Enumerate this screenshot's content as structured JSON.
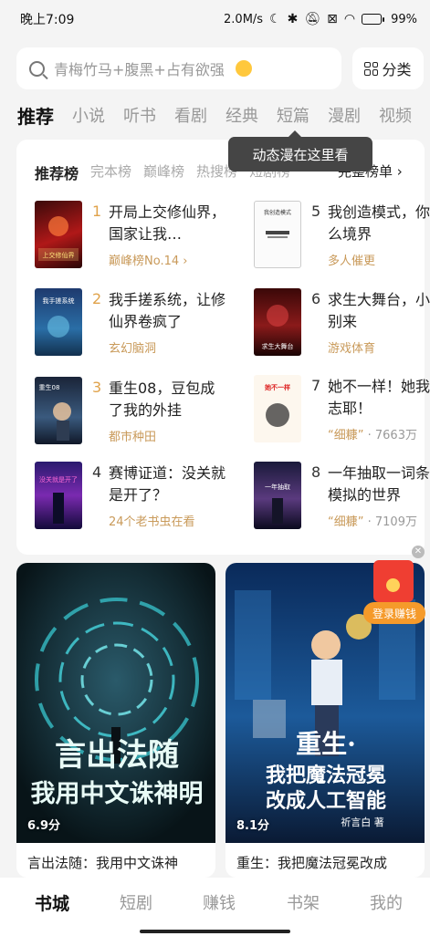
{
  "status_bar": {
    "time": "晚上7:09",
    "speed": "2.0M/s",
    "battery": "99%",
    "battery_level": 0.99
  },
  "search": {
    "placeholder": "青梅竹马+腹黑+占有欲强"
  },
  "category_button": "分类",
  "category_tabs": [
    "推荐",
    "小说",
    "听书",
    "看剧",
    "经典",
    "短篇",
    "漫剧",
    "视频"
  ],
  "tooltip": "动态漫在这里看",
  "ranking": {
    "tabs": [
      "推荐榜",
      "完本榜",
      "巅峰榜",
      "热搜榜",
      "短剧榜"
    ],
    "full_list": "完整榜单 ›",
    "books": [
      {
        "rank": "1",
        "title": "开局上交修仙界，国家让我…",
        "sub": "巅峰榜No.14 ›",
        "sub2": ""
      },
      {
        "rank": "2",
        "title": "我手搓系统，让修仙界卷疯了",
        "sub": "玄幻脑洞",
        "sub2": ""
      },
      {
        "rank": "3",
        "title": "重生08，豆包成了我的外挂",
        "sub": "都市种田",
        "sub2": ""
      },
      {
        "rank": "4",
        "title": "赛博证道：没关就是开了？",
        "sub": "24个老书虫在看",
        "sub2": ""
      },
      {
        "rank": "5",
        "title": "我创造模式，你什么境界",
        "sub": "多人催更",
        "sub2": ""
      },
      {
        "rank": "6",
        "title": "求生大舞台，小你别来",
        "sub": "游戏体育",
        "sub2": ""
      },
      {
        "rank": "7",
        "title": "她不一样！她我同志耶！",
        "sub": "“细糠”",
        "sub2": " · 7663万"
      },
      {
        "rank": "8",
        "title": "一年抽取一词条，模拟的世界",
        "sub": "“细糠”",
        "sub2": " · 7109万"
      }
    ],
    "cover_texts": [
      "上交修仙界",
      "我手搓系统",
      "重生08",
      "没关就是开了",
      "我创造模式",
      "求生大舞台",
      "她不一样",
      "一年抽取"
    ]
  },
  "feed": [
    {
      "score": "6.9分",
      "title": "言出法随：我用中文诛神",
      "cover_line1": "言出法随",
      "cover_line2": "我用中文诛神明"
    },
    {
      "score": "8.1分",
      "title": "重生：我把魔法冠冕改成",
      "cover_line1": "重生·",
      "cover_line2": "我把魔法冠冕",
      "cover_line3": "改成人工智能",
      "cover_author": "祈言白 著"
    }
  ],
  "promo": {
    "login_label": "登录赚钱"
  },
  "bottom_nav": [
    "书城",
    "短剧",
    "赚钱",
    "书架",
    "我的"
  ],
  "colors": {
    "accent_gold": "#c99a5a",
    "rank_gold": "#e0a24a",
    "promo_orange": "#f59a2a",
    "promo_red": "#ef3e32"
  }
}
